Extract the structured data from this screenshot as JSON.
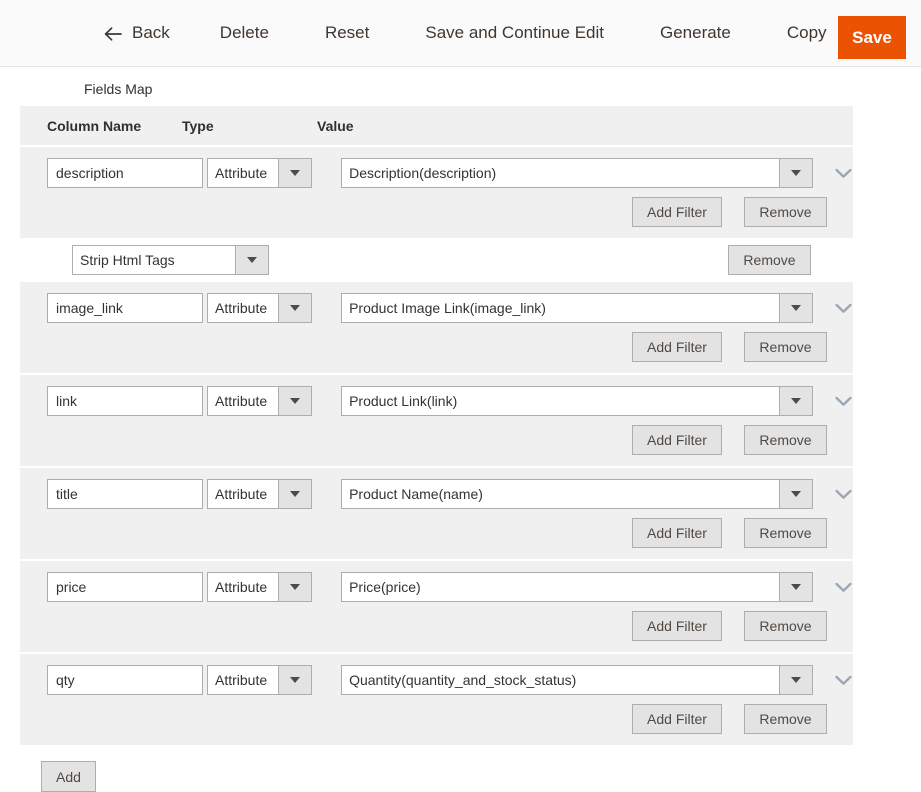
{
  "toolbar": {
    "back_label": "Back",
    "back_icon": "arrow-left-icon",
    "delete_label": "Delete",
    "reset_label": "Reset",
    "save_continue_label": "Save and Continue Edit",
    "generate_label": "Generate",
    "copy_label": "Copy",
    "save_label": "Save",
    "save_color": "#eb5202"
  },
  "fieldset": {
    "legend": "Fields Map"
  },
  "table": {
    "headers": {
      "column_name": "Column Name",
      "type": "Type",
      "value": "Value"
    },
    "row_actions": {
      "add_filter_label": "Add Filter",
      "remove_label": "Remove"
    },
    "rows": [
      {
        "column_name": "description",
        "type": "Attribute",
        "value": "Description(description)",
        "filters": [
          {
            "name": "Strip Html Tags",
            "remove_label": "Remove"
          }
        ]
      },
      {
        "column_name": "image_link",
        "type": "Attribute",
        "value": "Product Image Link(image_link)",
        "filters": []
      },
      {
        "column_name": "link",
        "type": "Attribute",
        "value": "Product Link(link)",
        "filters": []
      },
      {
        "column_name": "title",
        "type": "Attribute",
        "value": "Product Name(name)",
        "filters": []
      },
      {
        "column_name": "price",
        "type": "Attribute",
        "value": "Price(price)",
        "filters": []
      },
      {
        "column_name": "qty",
        "type": "Attribute",
        "value": "Quantity(quantity_and_stock_status)",
        "filters": []
      }
    ],
    "add_label": "Add"
  }
}
